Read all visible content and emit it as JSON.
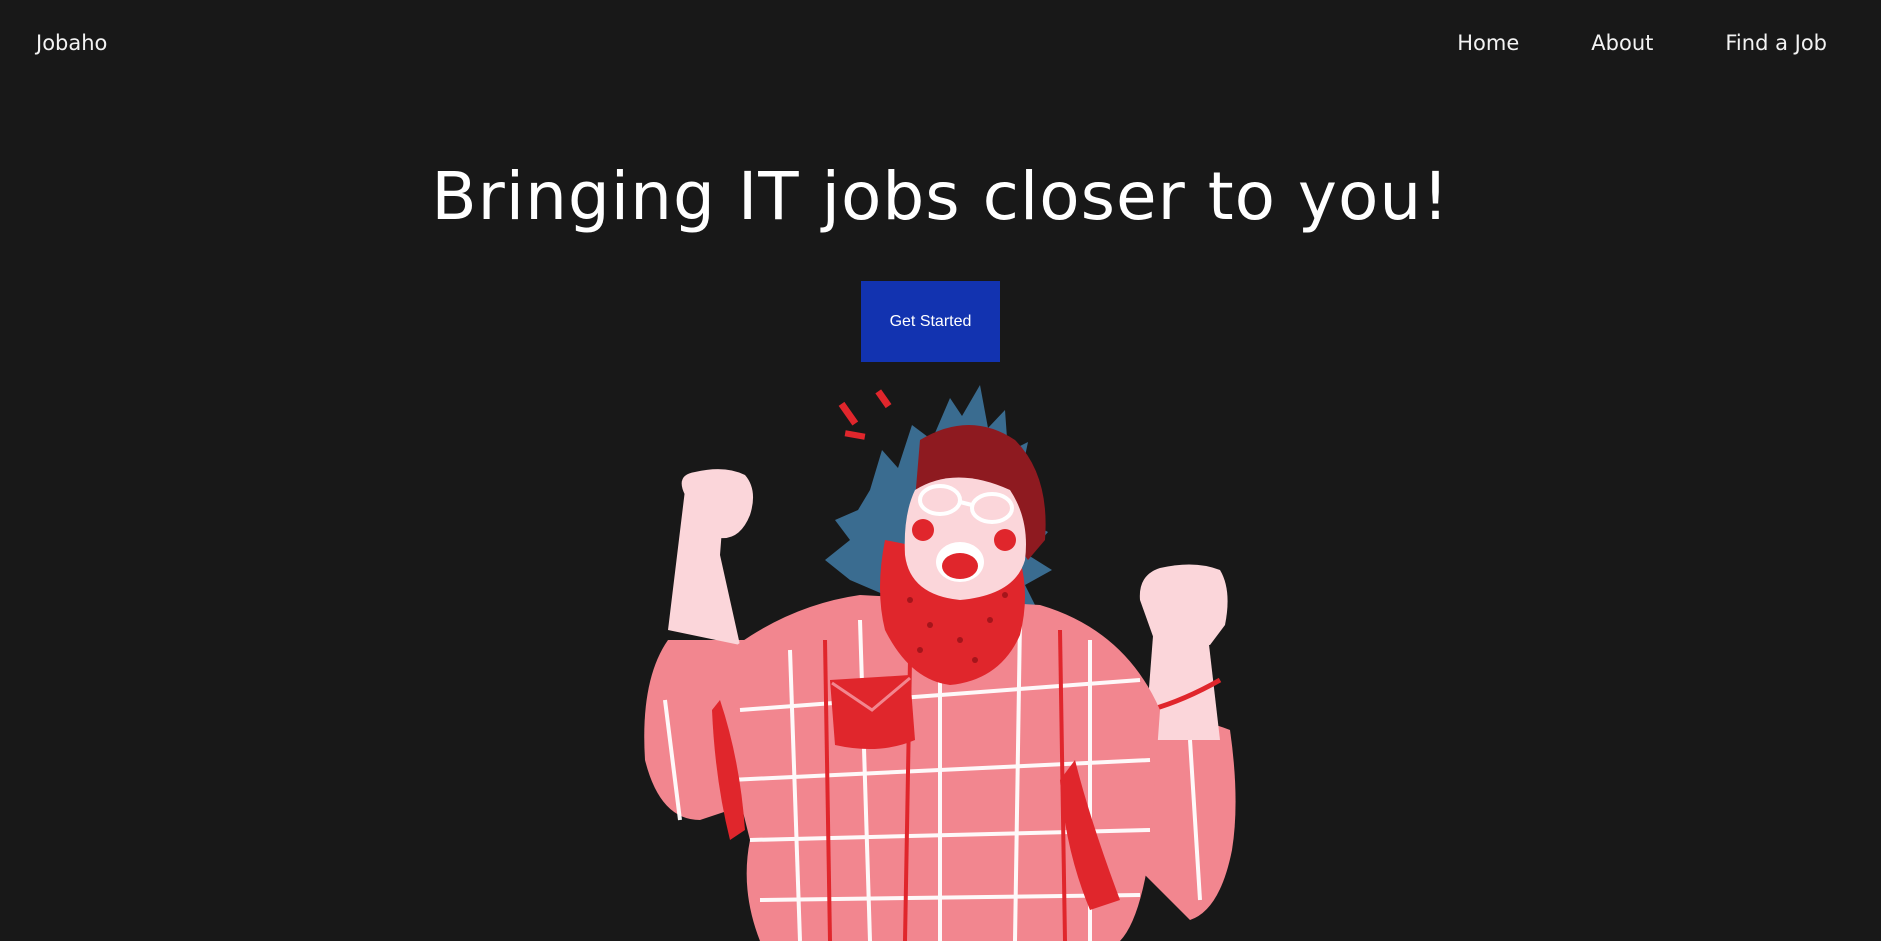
{
  "header": {
    "brand": "Jobaho",
    "nav": [
      {
        "label": "Home"
      },
      {
        "label": "About"
      },
      {
        "label": "Find a Job"
      }
    ]
  },
  "hero": {
    "title": "Bringing IT jobs closer to you!",
    "cta_label": "Get Started"
  },
  "colors": {
    "background": "#181818",
    "cta": "#1233b0",
    "hair": "#3a6c90",
    "shirt": "#f2868f",
    "accent_red": "#e0262c",
    "skin": "#fbd6da"
  }
}
